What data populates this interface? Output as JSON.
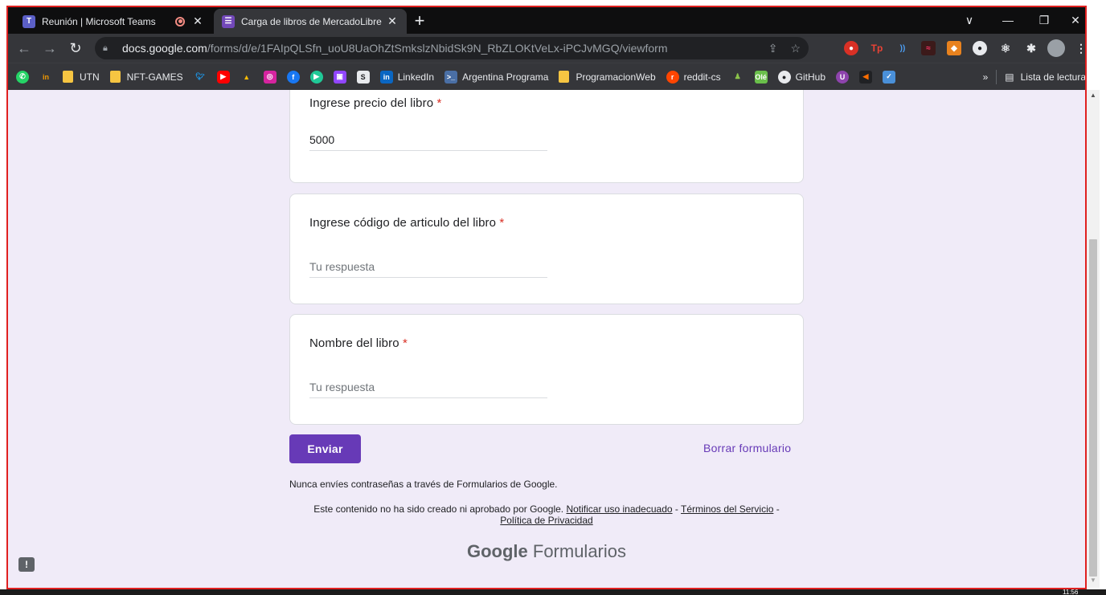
{
  "browser": {
    "tabs": [
      {
        "title": "Reunión | Microsoft Teams",
        "icon": "teams-icon"
      },
      {
        "title": "Carga de libros de MercadoLibre",
        "icon": "google-forms-icon"
      }
    ],
    "new_tab_symbol": "+",
    "window_controls": {
      "menu": "∨",
      "minimize": "—",
      "restore": "❐",
      "close": "✕"
    },
    "url_host": "docs.google.com",
    "url_path": "/forms/d/e/1FAIpQLSfn_uoU8UaOhZtSmkslzNbidSk9N_RbZLOKtVeLx-iPCJvMGQ/viewform",
    "bookmarks": {
      "utn": "UTN",
      "nft": "NFT-GAMES",
      "linkedin": "LinkedIn",
      "argentina": "Argentina Programa",
      "progweb": "ProgramacionWeb",
      "reddit": "reddit-cs",
      "github": "GitHub",
      "overflow": "»",
      "reading_list": "Lista de lectura"
    }
  },
  "form": {
    "questions": [
      {
        "title": "Ingrese precio del libro",
        "required_mark": "*",
        "value": "5000"
      },
      {
        "title": "Ingrese código de articulo del libro",
        "required_mark": "*",
        "placeholder": "Tu respuesta"
      },
      {
        "title": "Nombre del libro",
        "required_mark": "*",
        "placeholder": "Tu respuesta"
      }
    ],
    "submit_label": "Enviar",
    "clear_label": "Borrar formulario",
    "password_note": "Nunca envíes contraseñas a través de Formularios de Google.",
    "disclaimer_text": "Este contenido no ha sido creado ni aprobado por Google.",
    "report_link": "Notificar uso inadecuado",
    "separator": "-",
    "terms_link": "Términos del Servicio",
    "privacy_link": "Política de Privacidad",
    "brand_google": "Google",
    "brand_forms": "Formularios"
  },
  "taskbar": {
    "clock": "11:56"
  },
  "colors": {
    "accent": "#673ab7",
    "background": "#f0ebf8",
    "required": "#d93025",
    "highlight_border": "#e02020"
  }
}
